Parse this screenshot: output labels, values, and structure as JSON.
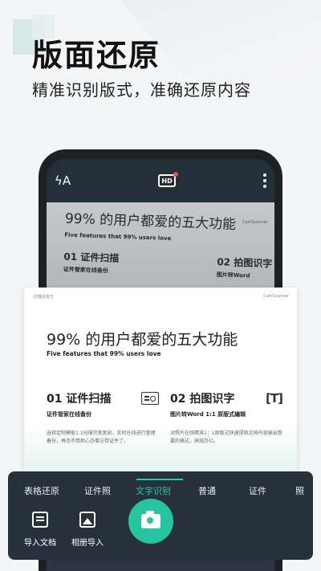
{
  "promo": {
    "headline": "版面还原",
    "subline": "精准识别版式，准确还原内容"
  },
  "phone": {
    "topbar": {
      "flash_icon": "flash-auto-icon",
      "flash_text": "ϟA",
      "hd_label": "HD",
      "more_icon": "more-vertical-icon"
    },
    "photo": {
      "title": "99% 的用户都爱的五大功能",
      "subtitle_en": "Five features that 99% users love",
      "brand": "CamScanner",
      "feature1": "01 证件扫描",
      "feature1_sub": "证件管家在线备份",
      "feature2": "02 拍图识字",
      "feature2_sub": "图片转Word"
    }
  },
  "card": {
    "app_name": "扫描全能王",
    "brand": "CamScanner",
    "title": "99% 的用户都爱的五大功能",
    "subtitle_en": "Five features that 99% users love",
    "features": [
      {
        "title": "01 证件扫描",
        "sub": "证件管家在线备份",
        "desc": "选择定制模板1:1扫描完美复刻，实时在线进行管理备份，再也不用担心办事忘带证件了。",
        "icon": "id-card-icon"
      },
      {
        "title": "02 拍图识字",
        "sub": "图片转Word 1:1 原版式编辑",
        "desc": "对照片在线精准1：1原版式快速提取文档内容输出想要的格式，高效办公。",
        "icon": "text-recognition-icon",
        "icon_text": "[T]"
      }
    ]
  },
  "panel": {
    "modes": [
      "表格还原",
      "证件照",
      "文字识别",
      "普通",
      "证件",
      "照"
    ],
    "active_mode": "文字识别",
    "import_doc": "导入文档",
    "import_album": "相册导入",
    "accent": "#2ec9a7"
  }
}
